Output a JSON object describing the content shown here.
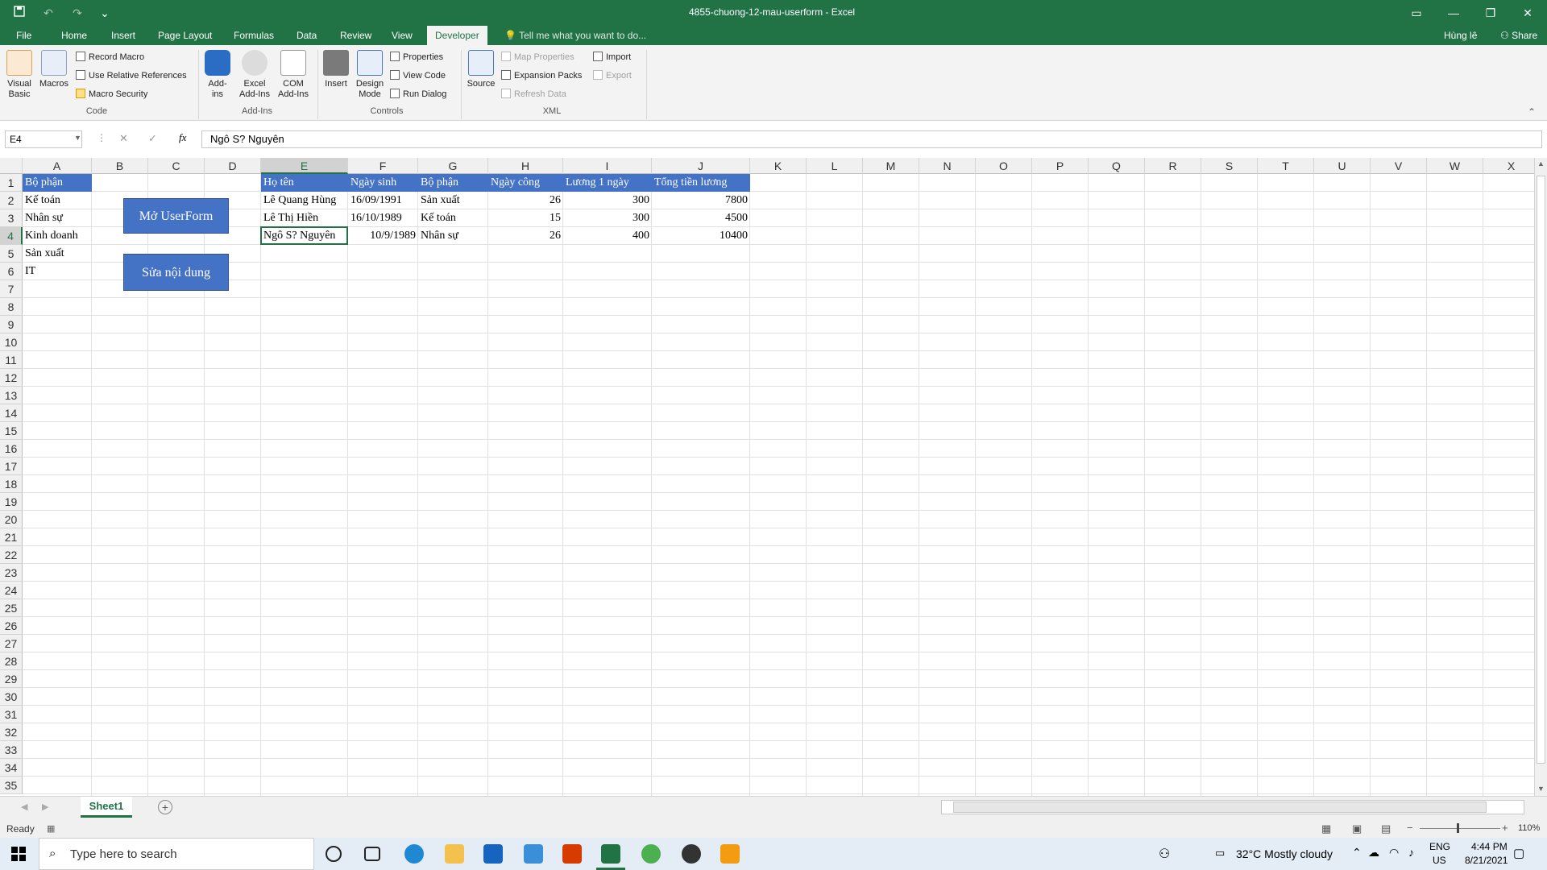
{
  "window": {
    "title": "4855-chuong-12-mau-userform - Excel",
    "user": "Hùng lê",
    "share_label": "Share"
  },
  "tabs": [
    "File",
    "Home",
    "Insert",
    "Page Layout",
    "Formulas",
    "Data",
    "Review",
    "View",
    "Developer"
  ],
  "tell_me": "Tell me what you want to do...",
  "ribbon": {
    "code": {
      "visual_basic": "Visual Basic",
      "macros": "Macros",
      "record_macro": "Record Macro",
      "relative_refs": "Use Relative References",
      "macro_security": "Macro Security",
      "group": "Code"
    },
    "addins": {
      "addins": "Add-ins",
      "excel_addins": "Excel Add-Ins",
      "com_addins": "COM Add-Ins",
      "group": "Add-Ins"
    },
    "controls": {
      "insert": "Insert",
      "design_mode": "Design Mode",
      "properties": "Properties",
      "view_code": "View Code",
      "run_dialog": "Run Dialog",
      "group": "Controls"
    },
    "xml": {
      "source": "Source",
      "map_properties": "Map Properties",
      "expansion_packs": "Expansion Packs",
      "refresh_data": "Refresh Data",
      "import": "Import",
      "export": "Export",
      "group": "XML"
    }
  },
  "formula_bar": {
    "name_box": "E4",
    "content": "Ngô S? Nguyên"
  },
  "columns": [
    "A",
    "B",
    "C",
    "D",
    "E",
    "F",
    "G",
    "H",
    "I",
    "J",
    "K",
    "L",
    "M",
    "N",
    "O",
    "P",
    "Q",
    "R",
    "S",
    "T",
    "U",
    "V",
    "W",
    "X"
  ],
  "rows": [
    "1",
    "2",
    "3",
    "4",
    "5",
    "6",
    "7",
    "8",
    "9",
    "10",
    "11",
    "12",
    "13",
    "14",
    "15",
    "16",
    "17",
    "18",
    "19",
    "20",
    "21",
    "22",
    "23",
    "24",
    "25",
    "26",
    "27",
    "28",
    "29",
    "30",
    "31",
    "32",
    "33",
    "34",
    "35"
  ],
  "cells": {
    "A1": "Bộ phận",
    "A2": "Kế toán",
    "A3": "Nhân sự",
    "A4": "Kinh doanh",
    "A5": "Sản xuất",
    "A6": "IT",
    "E1": "Họ tên",
    "F1": "Ngày sinh",
    "G1": "Bộ phận",
    "H1": "Ngày công",
    "I1": "Lương 1 ngày",
    "J1": "Tổng tiền lương",
    "E2": "Lê Quang Hùng",
    "F2": "16/09/1991",
    "G2": "Sản xuất",
    "H2": "26",
    "I2": "300",
    "J2": "7800",
    "E3": "Lê Thị Hiền",
    "F3": "16/10/1989",
    "G3": "Kế toán",
    "H3": "15",
    "I3": "300",
    "J3": "4500",
    "E4": "Ngô S? Nguyên",
    "F4": "10/9/1989",
    "G4": "Nhân sự",
    "H4": "26",
    "I4": "400",
    "J4": "10400"
  },
  "buttons": {
    "open_userform": "Mở UserForm",
    "edit_content": "Sửa nội dung"
  },
  "sheet_tab": "Sheet1",
  "status": {
    "ready": "Ready",
    "zoom": "110%"
  },
  "taskbar": {
    "search_placeholder": "Type here to search",
    "weather": "32°C  Mostly cloudy",
    "lang": "ENG",
    "region": "US",
    "time": "4:44 PM",
    "date": "8/21/2021"
  },
  "colors": {
    "excel_green": "#217346",
    "header_fill": "#4472c4"
  }
}
